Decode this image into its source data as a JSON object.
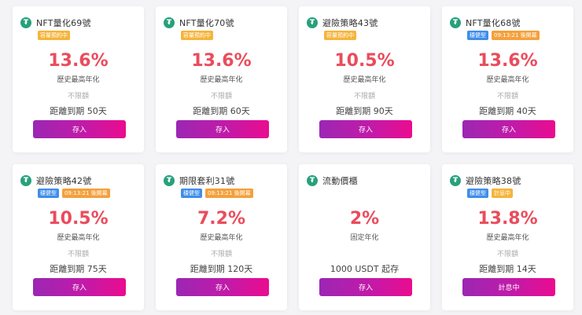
{
  "coin_icon_glyph": "₮",
  "cards": [
    {
      "title": "NFT量化69號",
      "tags": [
        {
          "text": "容量預約中",
          "color": "yellow"
        }
      ],
      "rate": "13.6%",
      "rate_label": "歷史最高年化",
      "limit": "不限額",
      "term": "距離到期 50天",
      "button": "存入"
    },
    {
      "title": "NFT量化70號",
      "tags": [
        {
          "text": "容量預約中",
          "color": "yellow"
        }
      ],
      "rate": "13.6%",
      "rate_label": "歷史最高年化",
      "limit": "不限額",
      "term": "距離到期 60天",
      "button": "存入"
    },
    {
      "title": "避險策略43號",
      "tags": [
        {
          "text": "容量預約中",
          "color": "yellow"
        }
      ],
      "rate": "10.5%",
      "rate_label": "歷史最高年化",
      "limit": "不限額",
      "term": "距離到期 90天",
      "button": "存入"
    },
    {
      "title": "NFT量化68號",
      "tags": [
        {
          "text": "穩健型",
          "color": "blue"
        },
        {
          "text": "09:13:21 後開幕",
          "color": "orange"
        }
      ],
      "rate": "13.6%",
      "rate_label": "歷史最高年化",
      "limit": "不限額",
      "term": "距離到期 40天",
      "button": "存入"
    },
    {
      "title": "避險策略42號",
      "tags": [
        {
          "text": "穩健型",
          "color": "blue"
        },
        {
          "text": "09:13:21 後開幕",
          "color": "orange"
        }
      ],
      "rate": "10.5%",
      "rate_label": "歷史最高年化",
      "limit": "不限額",
      "term": "距離到期 75天",
      "button": "存入"
    },
    {
      "title": "期限套利31號",
      "tags": [
        {
          "text": "穩健型",
          "color": "blue"
        },
        {
          "text": "09:13:21 後開幕",
          "color": "orange"
        }
      ],
      "rate": "7.2%",
      "rate_label": "歷史最高年化",
      "limit": "不限額",
      "term": "距離到期 120天",
      "button": "存入"
    },
    {
      "title": "流動價櫃",
      "tags": [],
      "rate": "2%",
      "rate_label": "固定年化",
      "limit": "",
      "term": "1000 USDT 起存",
      "button": "存入"
    },
    {
      "title": "避險策略38號",
      "tags": [
        {
          "text": "穩健型",
          "color": "blue"
        },
        {
          "text": "計息中",
          "color": "yellow"
        }
      ],
      "rate": "13.8%",
      "rate_label": "歷史最高年化",
      "limit": "不限額",
      "term": "距離到期 14天",
      "button": "計息中"
    }
  ]
}
